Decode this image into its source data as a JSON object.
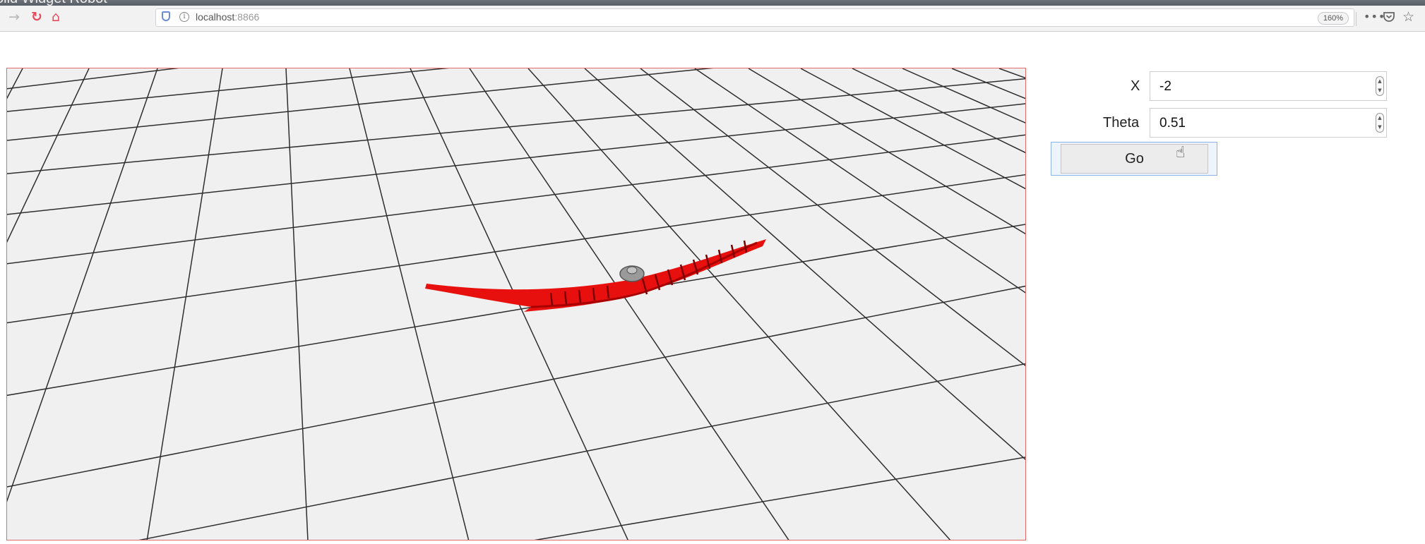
{
  "window": {
    "title": "olid Widget Robot"
  },
  "browser": {
    "icons": [
      "forward-arrow-icon",
      "reload-icon",
      "home-icon",
      "shield-icon",
      "info-icon",
      "more-icon",
      "pocket-icon",
      "bookmark-star-icon"
    ],
    "url_host": "localhost",
    "url_port": ":8866",
    "zoom": "160%",
    "accent_home": "#e8495b"
  },
  "form": {
    "x_label": "X",
    "x_value": "-2",
    "theta_label": "Theta",
    "theta_value": "0.51",
    "go_label": "Go"
  },
  "scene": {
    "description_colors": {
      "floor": "#f0f0f0",
      "grid": "#2e2e2e",
      "robot_body": "#e8100e",
      "robot_hub": "#9a9a9a",
      "frame": "#e06a6a"
    }
  }
}
